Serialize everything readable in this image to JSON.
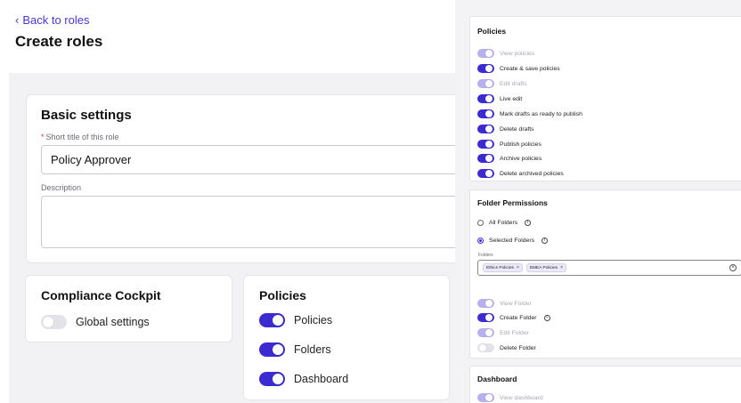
{
  "header": {
    "back_label": "Back to roles",
    "page_title": "Create roles"
  },
  "basic_settings": {
    "title": "Basic settings",
    "short_title_label": "Short title of this role",
    "short_title_value": "Policy Approver",
    "description_label": "Description",
    "description_value": ""
  },
  "compliance_cockpit": {
    "title": "Compliance Cockpit",
    "items": [
      {
        "label": "Global settings",
        "state": "off"
      }
    ]
  },
  "policies_card": {
    "title": "Policies",
    "items": [
      {
        "label": "Policies",
        "state": "on"
      },
      {
        "label": "Folders",
        "state": "on"
      },
      {
        "label": "Dashboard",
        "state": "on"
      }
    ]
  },
  "panel": {
    "policies": {
      "title": "Policies",
      "items": [
        {
          "label": "View policies",
          "state": "dim"
        },
        {
          "label": "Create & save policies",
          "state": "on"
        },
        {
          "label": "Edit drafts",
          "state": "dim"
        },
        {
          "label": "Live edit",
          "state": "on"
        },
        {
          "label": "Mark drafts as ready to publish",
          "state": "on"
        },
        {
          "label": "Delete drafts",
          "state": "on"
        },
        {
          "label": "Publish policies",
          "state": "on"
        },
        {
          "label": "Archive policies",
          "state": "on"
        },
        {
          "label": "Delete archived policies",
          "state": "on"
        }
      ]
    },
    "folder_permissions": {
      "title": "Folder Permissions",
      "radio_all": "All Folders",
      "radio_selected": "Selected Folders",
      "selected_option": "Selected Folders",
      "folders_label": "Folders",
      "chips": [
        "Ethics Policies",
        "EMEA Policies"
      ],
      "items": [
        {
          "label": "View Folder",
          "state": "dim"
        },
        {
          "label": "Create Folder",
          "state": "on"
        },
        {
          "label": "Edit Folder",
          "state": "dim"
        },
        {
          "label": "Delete Folder",
          "state": "off"
        }
      ]
    },
    "dashboard": {
      "title": "Dashboard",
      "items": [
        {
          "label": "View dashboard",
          "state": "dim"
        }
      ]
    }
  },
  "colors": {
    "accent": "#3b2bd1",
    "accent_dim": "#b7b0ee",
    "toggle_off": "#e2e2e8",
    "link": "#4a38d4",
    "required": "#e0334b"
  }
}
